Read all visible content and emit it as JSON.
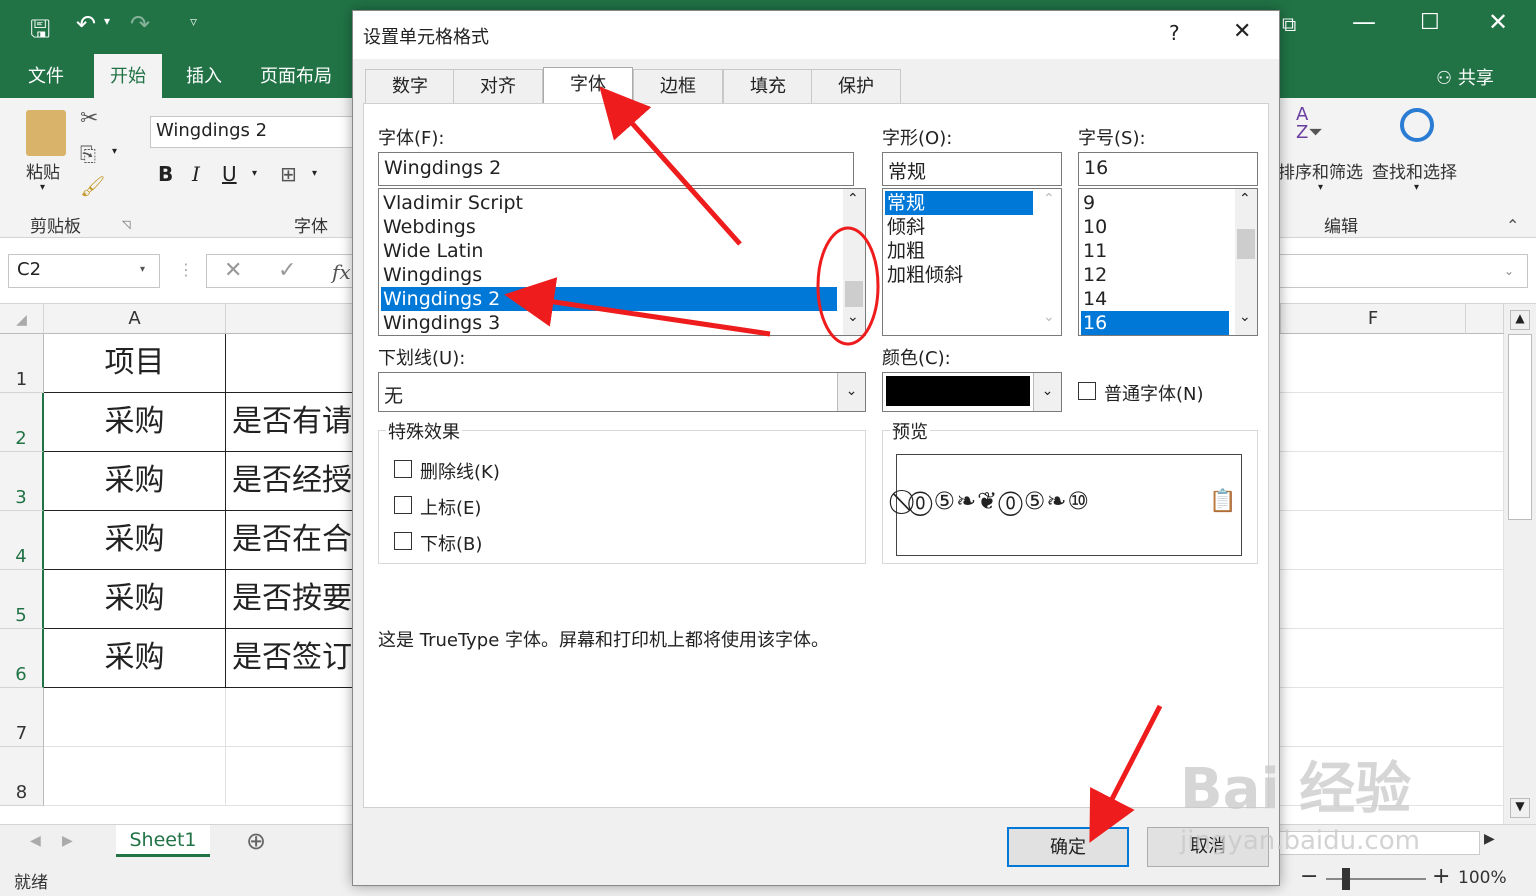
{
  "ribbon": {
    "tabs": [
      "文件",
      "开始",
      "插入",
      "页面布局"
    ],
    "share": "共享",
    "font_name": "Wingdings 2",
    "paste_label": "粘贴",
    "clipboard_label": "剪贴板",
    "font_group_label": "字体",
    "sort_filter_label": "排序和筛选",
    "find_select_label": "查找和选择",
    "edit_group_label": "编辑",
    "fx": "fx"
  },
  "namebox": "C2",
  "grid": {
    "col_a": "A",
    "col_f": "F",
    "rows": [
      {
        "num": "1",
        "a": "项目",
        "b": ""
      },
      {
        "num": "2",
        "a": "采购",
        "b": "是否有请"
      },
      {
        "num": "3",
        "a": "采购",
        "b": "是否经授"
      },
      {
        "num": "4",
        "a": "采购",
        "b": "是否在合"
      },
      {
        "num": "5",
        "a": "采购",
        "b": "是否按要"
      },
      {
        "num": "6",
        "a": "采购",
        "b": "是否签订"
      },
      {
        "num": "7",
        "a": "",
        "b": ""
      },
      {
        "num": "8",
        "a": "",
        "b": ""
      }
    ]
  },
  "sheet_tab": "Sheet1",
  "status": {
    "ready": "就绪",
    "zoom": "100%"
  },
  "dialog": {
    "title": "设置单元格格式",
    "help": "?",
    "close": "✕",
    "tabs": [
      "数字",
      "对齐",
      "字体",
      "边框",
      "填充",
      "保护"
    ],
    "font_label": "字体(F):",
    "font_value": "Wingdings 2",
    "font_list": [
      "Vladimir Script",
      "Webdings",
      "Wide Latin",
      "Wingdings",
      "Wingdings 2",
      "Wingdings 3"
    ],
    "style_label": "字形(O):",
    "style_value": "常规",
    "style_list": [
      "常规",
      "倾斜",
      "加粗",
      "加粗倾斜"
    ],
    "size_label": "字号(S):",
    "size_value": "16",
    "size_list": [
      "9",
      "10",
      "11",
      "12",
      "14",
      "16"
    ],
    "underline_label": "下划线(U):",
    "underline_value": "无",
    "color_label": "颜色(C):",
    "color_value": "#000000",
    "normal_font_label": "普通字体(N)",
    "effects_label": "特殊效果",
    "strike_label": "删除线(K)",
    "super_label": "上标(E)",
    "sub_label": "下标(B)",
    "preview_label": "预览",
    "preview_text": "⃠⓪⑤❧❦⓪⑤❧⑩",
    "info": "这是 TrueType 字体。屏幕和打印机上都将使用该字体。",
    "ok": "确定",
    "cancel": "取消"
  },
  "watermark": {
    "line1": "Bai 经验",
    "line2": "jingyan.baidu.com"
  }
}
